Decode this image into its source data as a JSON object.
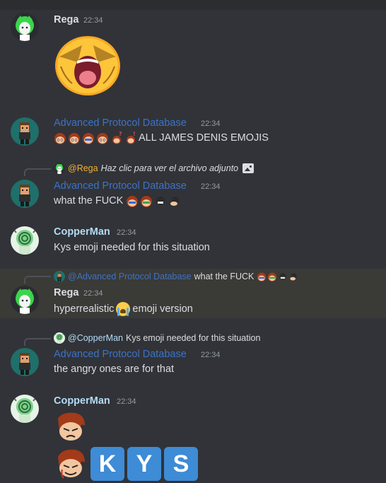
{
  "colors": {
    "rega": "#f0b232",
    "apd": "#3c73c7",
    "copperman": "#b4dcf5",
    "background": "#313338",
    "highlight": "#3a3a37",
    "key": "#3e8bd6"
  },
  "messages": [
    {
      "author": "Rega",
      "time": "22:34",
      "attachment_icon": "screaming-face-sticker"
    },
    {
      "author": "Advanced Protocol Database",
      "time": "22:34",
      "text": "ALL JAMES DENIS EMOJIS"
    },
    {
      "reply_to": "@Rega",
      "reply_text": "Haz clic para ver el archivo adjunto",
      "author": "Advanced Protocol Database",
      "time": "22:34",
      "text": "what the FUCK"
    },
    {
      "author": "CopperMan",
      "time": "22:34",
      "text": "Kys emoji needed for this situation"
    },
    {
      "reply_to": "@Advanced Protocol Database",
      "reply_text": "what the FUCK",
      "author": "Rega",
      "time": "22:34",
      "text_before": "hyperrealistic",
      "text_after": "emoji version"
    },
    {
      "reply_to": "@CopperMan",
      "reply_text": "Kys emoji needed for this situation",
      "author": "Advanced Protocol Database",
      "time": "22:34",
      "text": "the angry ones are for that"
    },
    {
      "author": "CopperMan",
      "time": "22:34",
      "keys": [
        "K",
        "Y",
        "S"
      ]
    }
  ]
}
